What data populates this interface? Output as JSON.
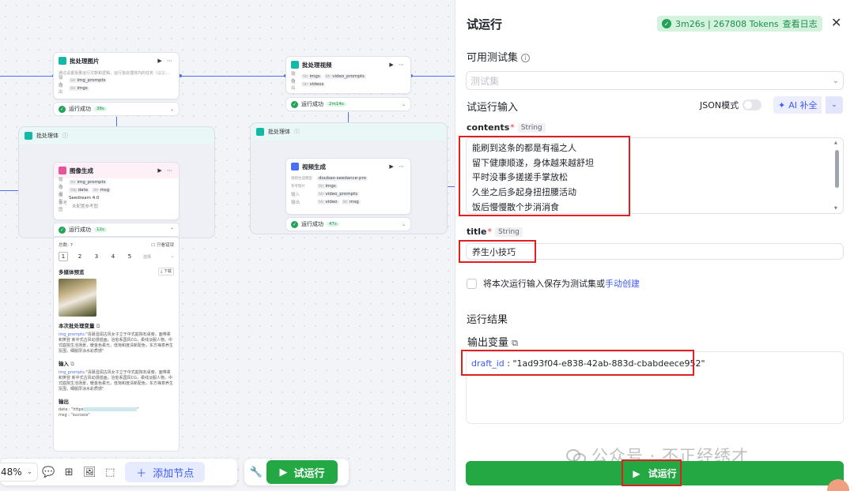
{
  "canvas": {
    "nodes": {
      "batch_img": {
        "title": "批处理图片",
        "desc": "通过设置批量运行次数和逻辑，运行批处理体内的任务（以父...",
        "in_key": "输入",
        "in_chip": "img_prompts",
        "in_type": "Str",
        "out_key": "输出",
        "out_chip": "imgs",
        "out_type": "Str",
        "actions": "▶ ⋯"
      },
      "batch_img_status": {
        "label": "运行成功",
        "time": "38s"
      },
      "batch_vid": {
        "title": "批处理视频",
        "in_key": "输入",
        "in_chip1": "imgs",
        "in_chip2": "video_prompts",
        "in_type1": "Str",
        "in_type2": "Str",
        "out_key": "输出",
        "out_chip": "videos",
        "out_type": "Str",
        "actions": "▶ ⋯"
      },
      "batch_vid_status": {
        "label": "运行成功",
        "time": "2m14s"
      },
      "group_left": {
        "title": "批处理体"
      },
      "group_right": {
        "title": "批处理体"
      },
      "img_gen": {
        "title": "图像生成",
        "in_key": "输入",
        "in_chip": "img_prompts",
        "in_type": "Str",
        "out_key": "输出",
        "out_chip1": "data",
        "out_chip2": "msg",
        "out_type1": "Obj",
        "out_type2": "Str",
        "model_key": "模型",
        "model": "Seedream 4.0",
        "ref_key": "参考图",
        "ref": "未配置参考图",
        "actions": "▶ ⋯"
      },
      "img_gen_status": {
        "label": "运行成功",
        "time": "12s"
      },
      "vid_gen": {
        "title": "视频生成",
        "model_key": "视频生成模型",
        "model": "doubao-seedance-pro",
        "ref_key": "参考图片",
        "ref_chip": "imgs",
        "ref_type": "Str",
        "in_key": "输入",
        "in_chip": "video_prompts",
        "in_type": "Str",
        "out_key": "输出",
        "out_chip1": "video",
        "out_chip2": "msg",
        "out_type1": "Str",
        "out_type2": "Str",
        "actions": "▶ ⋯"
      },
      "vid_gen_status": {
        "label": "运行成功",
        "time": "47s"
      }
    },
    "result_card": {
      "total": "总数: 7",
      "only_error": "只看错误",
      "pages": [
        "1",
        "2",
        "3",
        "4",
        "5"
      ],
      "page_select": "选择",
      "media_title": "多媒体预览",
      "download": "下载",
      "vars_title": "本次批处理变量",
      "vars_key": "img_prompts:",
      "vars_text": "\"清晨湿润古风女子立于中式庭院石桌旁，面带柔和笑容 新中式古风动漫插画，治愈系国风CG，柔线淡服人物，中式庭院生活场景，暖金色柔光，低饱和度清新配色，东方禅意养生氛围，细腻厚涂水彩质感\"",
      "input_title": "输入",
      "input_key": "img_prompts:",
      "input_text": "\"清晨湿润古风女子立于中式庭院石桌旁，面带柔和笑容 新中式古风动漫插画，治愈系国风CG，柔线淡服人物，中式庭院生活场景，暖金色柔光，低饱和度清新配色，东方禅意养生氛围，细腻厚涂水彩质感\"",
      "output_title": "输出",
      "out_data": "data : \"https",
      "out_msg": "msg : \"success\""
    },
    "toolbar": {
      "zoom": "48%",
      "add_node": "添加节点",
      "run": "试运行"
    }
  },
  "panel": {
    "title": "试运行",
    "badge": "3m26s | 267808 Tokens",
    "view_log": "查看日志",
    "test_set_label": "可用测试集",
    "test_set_placeholder": "测试集",
    "input_label": "试运行输入",
    "json_mode": "JSON模式",
    "ai_fill": "AI 补全",
    "contents": {
      "name": "contents",
      "type": "String",
      "lines": [
        "能刷到这条的都是有福之人",
        "留下健康顺遂，身体越来越舒坦",
        "平时没事多搓搓手掌放松",
        "久坐之后多起身扭扭腰活动",
        "饭后慢慢散个步消消食"
      ]
    },
    "title_field": {
      "name": "title",
      "type": "String",
      "value": "养生小技巧"
    },
    "save_text": "将本次运行输入保存为测试集或",
    "save_link": "手动创建",
    "result_label": "运行结果",
    "output_label": "输出变量",
    "output_key": "draft_id",
    "output_value": " : \"1ad93f04-e838-42ab-883d-cbabdeece952\"",
    "run_button": "试运行"
  },
  "watermark": "公众号 · 不正经绣才",
  "colors": {
    "accent": "#4e6ef2",
    "success": "#23a844",
    "highlight": "#e02020"
  }
}
